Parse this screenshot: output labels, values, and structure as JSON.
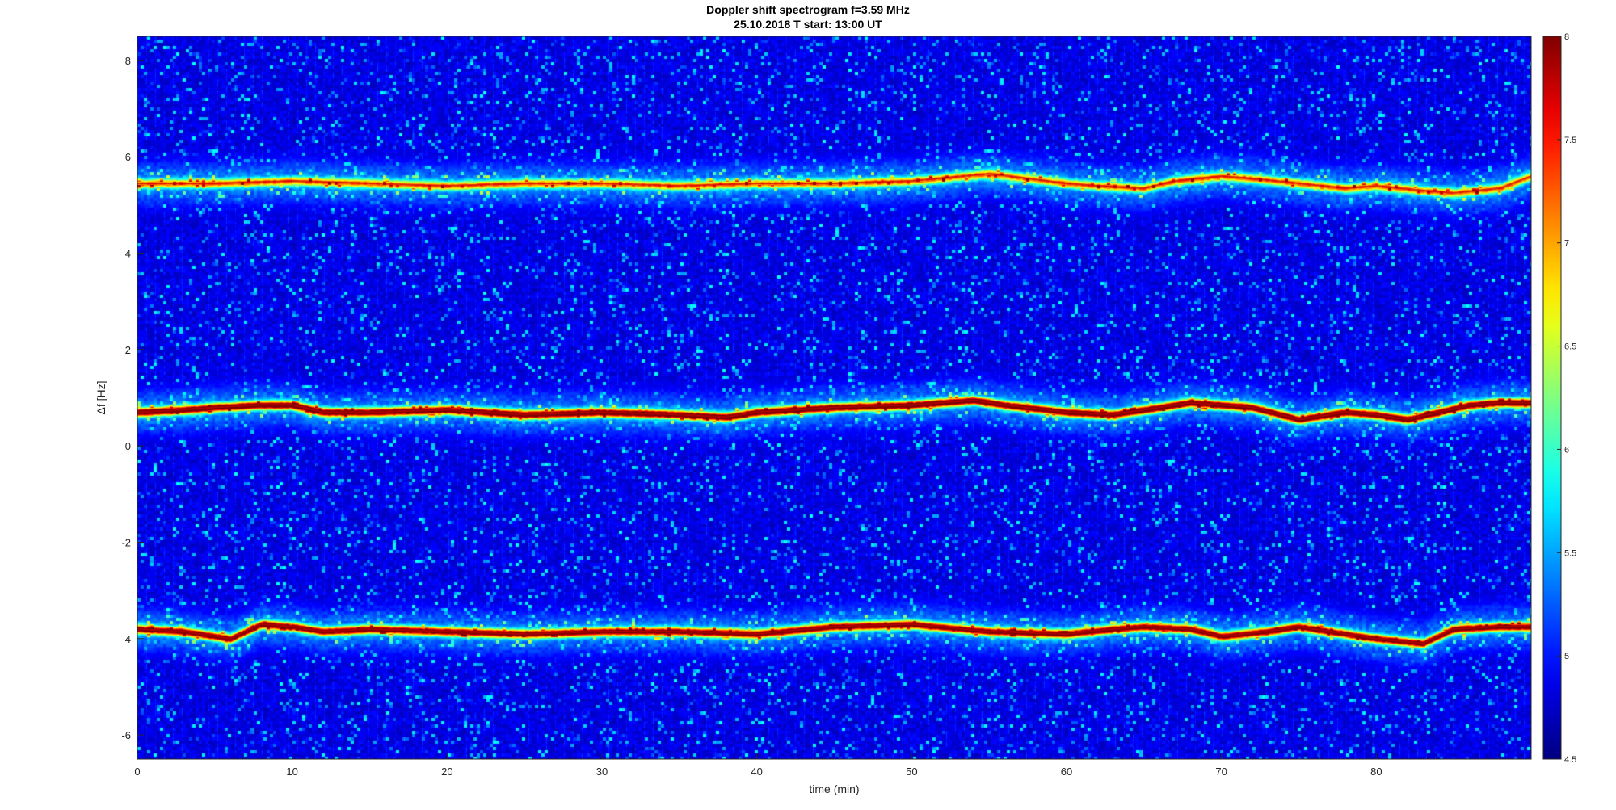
{
  "chart_data": {
    "type": "heatmap",
    "title": "Doppler shift spectrogram f=3.59 MHz",
    "subtitle": "25.10.2018    T start: 13:00 UT",
    "xlabel": "time (min)",
    "ylabel": "Δf [Hz]",
    "xlim": [
      0,
      90
    ],
    "ylim": [
      -6.5,
      8.5
    ],
    "xticks": [
      0,
      10,
      20,
      30,
      40,
      50,
      60,
      70,
      80
    ],
    "yticks": [
      -6,
      -4,
      -2,
      0,
      2,
      4,
      6,
      8
    ],
    "colorbar": {
      "colormap": "jet",
      "clim": [
        4.5,
        8
      ],
      "ticks": [
        4.5,
        5,
        5.5,
        6,
        6.5,
        7,
        7.5,
        8
      ]
    },
    "background_level": 4.7,
    "series": [
      {
        "x": [
          0,
          5,
          10,
          15,
          20,
          25,
          30,
          35,
          40,
          45,
          50,
          55,
          60,
          62,
          65,
          67,
          70,
          72,
          75,
          78,
          80,
          83,
          85,
          88,
          90
        ],
        "y": [
          5.45,
          5.45,
          5.5,
          5.45,
          5.4,
          5.45,
          5.45,
          5.4,
          5.45,
          5.45,
          5.5,
          5.65,
          5.45,
          5.4,
          5.35,
          5.5,
          5.6,
          5.55,
          5.45,
          5.35,
          5.4,
          5.3,
          5.25,
          5.35,
          5.6
        ],
        "peak": 6.6
      },
      {
        "x": [
          0,
          3,
          5,
          8,
          10,
          12,
          15,
          20,
          25,
          30,
          35,
          38,
          40,
          45,
          50,
          54,
          56,
          60,
          63,
          65,
          68,
          70,
          72,
          75,
          78,
          80,
          82,
          84,
          86,
          88,
          90
        ],
        "y": [
          0.7,
          0.75,
          0.8,
          0.85,
          0.85,
          0.7,
          0.7,
          0.75,
          0.65,
          0.7,
          0.65,
          0.6,
          0.7,
          0.8,
          0.85,
          0.95,
          0.85,
          0.7,
          0.65,
          0.75,
          0.9,
          0.85,
          0.8,
          0.55,
          0.7,
          0.65,
          0.55,
          0.7,
          0.85,
          0.9,
          0.9
        ],
        "peak": 7.8
      },
      {
        "x": [
          0,
          3,
          6,
          8,
          10,
          12,
          15,
          20,
          25,
          30,
          35,
          40,
          45,
          50,
          55,
          60,
          63,
          65,
          68,
          70,
          73,
          75,
          78,
          80,
          83,
          85,
          88,
          90
        ],
        "y": [
          -3.8,
          -3.85,
          -4.0,
          -3.7,
          -3.75,
          -3.85,
          -3.8,
          -3.85,
          -3.9,
          -3.85,
          -3.85,
          -3.9,
          -3.75,
          -3.7,
          -3.85,
          -3.9,
          -3.8,
          -3.75,
          -3.8,
          -3.95,
          -3.85,
          -3.75,
          -3.9,
          -4.0,
          -4.1,
          -3.8,
          -3.75,
          -3.75
        ],
        "peak": 7.6
      }
    ]
  }
}
